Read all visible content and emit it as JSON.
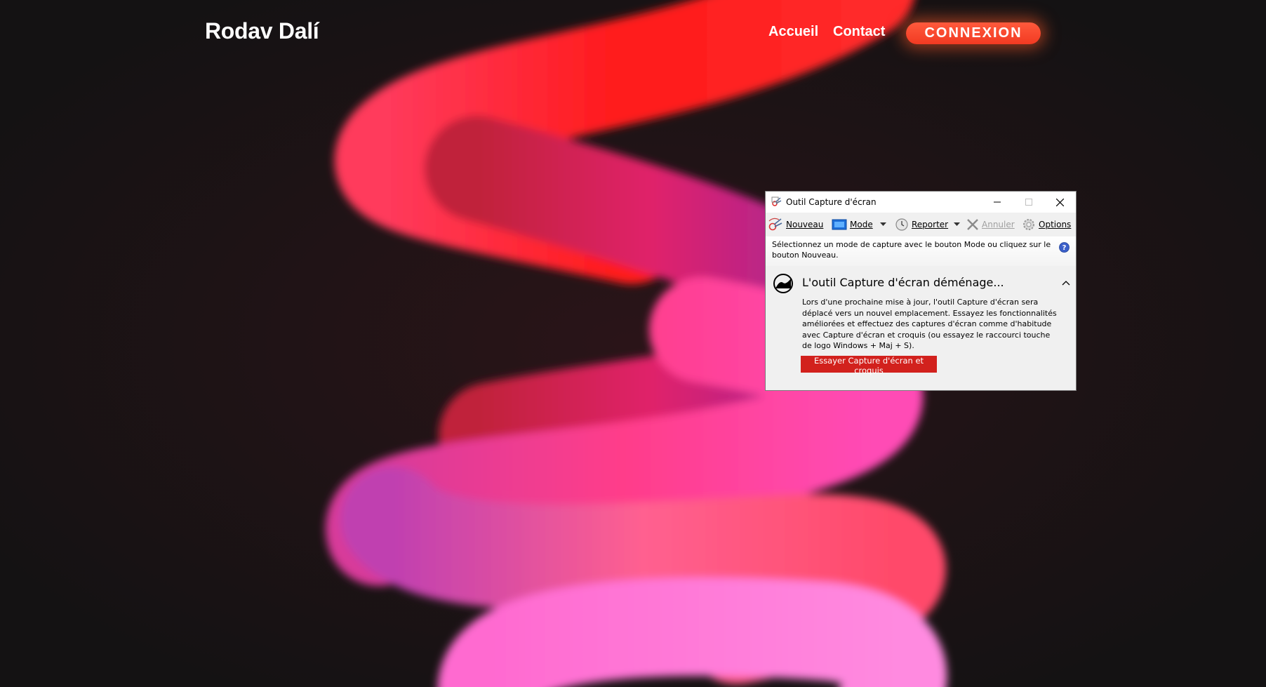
{
  "site": {
    "brand": "Rodav Dalí",
    "nav": {
      "home": "Accueil",
      "contact": "Contact"
    },
    "login_button": "CONNEXION",
    "colors": {
      "background": "#141213",
      "accent": "#f23a22"
    }
  },
  "snipping_tool": {
    "title": "Outil Capture d'écran",
    "toolbar": {
      "new": "Nouveau",
      "mode": "Mode",
      "delay": "Reporter",
      "cancel": "Annuler",
      "options": "Options"
    },
    "info": "Sélectionnez un mode de capture avec le bouton Mode ou cliquez sur le bouton Nouveau.",
    "notice": {
      "title": "L'outil Capture d'écran déménage...",
      "body": "Lors d'une prochaine mise à jour, l'outil Capture d'écran sera déplacé vers un nouvel emplacement. Essayez les fonctionnalités améliorées et effectuez des captures d'écran comme d'habitude avec Capture d'écran et croquis (ou essayez le raccourci touche de logo Windows + Maj + S).",
      "button": "Essayer Capture d'écran et croquis"
    },
    "icons": [
      "snip-icon",
      "mode-icon",
      "clock-icon",
      "cancel-x-icon",
      "gear-icon",
      "help-icon",
      "snip-sketch-icon",
      "chevron-up-icon"
    ]
  }
}
